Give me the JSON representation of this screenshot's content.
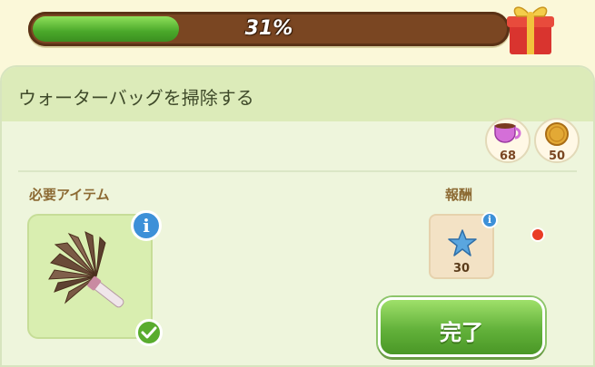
{
  "progress": {
    "percent": 31,
    "label": "31%"
  },
  "task": {
    "title": "ウォーターバッグを掃除する"
  },
  "resources": [
    {
      "icon": "teacup-icon",
      "value": "68"
    },
    {
      "icon": "gold-coin-icon",
      "value": "50"
    }
  ],
  "required": {
    "label": "必要アイテム",
    "item_icon": "feather-duster-icon",
    "status": "check"
  },
  "reward": {
    "label": "報酬",
    "icon": "blue-star-icon",
    "value": "30"
  },
  "actions": {
    "done_label": "完了"
  },
  "colors": {
    "progress": "#4aa82a",
    "button": "#62b13a",
    "accent": "#7a4622"
  }
}
